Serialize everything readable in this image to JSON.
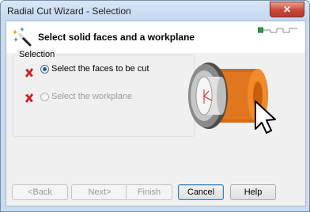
{
  "window": {
    "title": "Radial Cut Wizard - Selection",
    "close_label": "✕"
  },
  "header": {
    "title": "Select solid faces and a workplane"
  },
  "group": {
    "legend": "Selection",
    "options": [
      {
        "label": "Select the faces to be cut",
        "checked": true,
        "enabled": true,
        "status_icon": "red-x-icon"
      },
      {
        "label": "Select the workplane",
        "checked": false,
        "enabled": false,
        "status_icon": "red-x-icon"
      }
    ]
  },
  "buttons": {
    "back": "<Back",
    "next": "Next>",
    "finish": "Finish",
    "cancel": "Cancel",
    "help": "Help"
  },
  "colors": {
    "status_error": "#cc1f1f",
    "accent": "#3c7fb1",
    "part_orange": "#d86a12",
    "step_active": "#2f9e44"
  }
}
